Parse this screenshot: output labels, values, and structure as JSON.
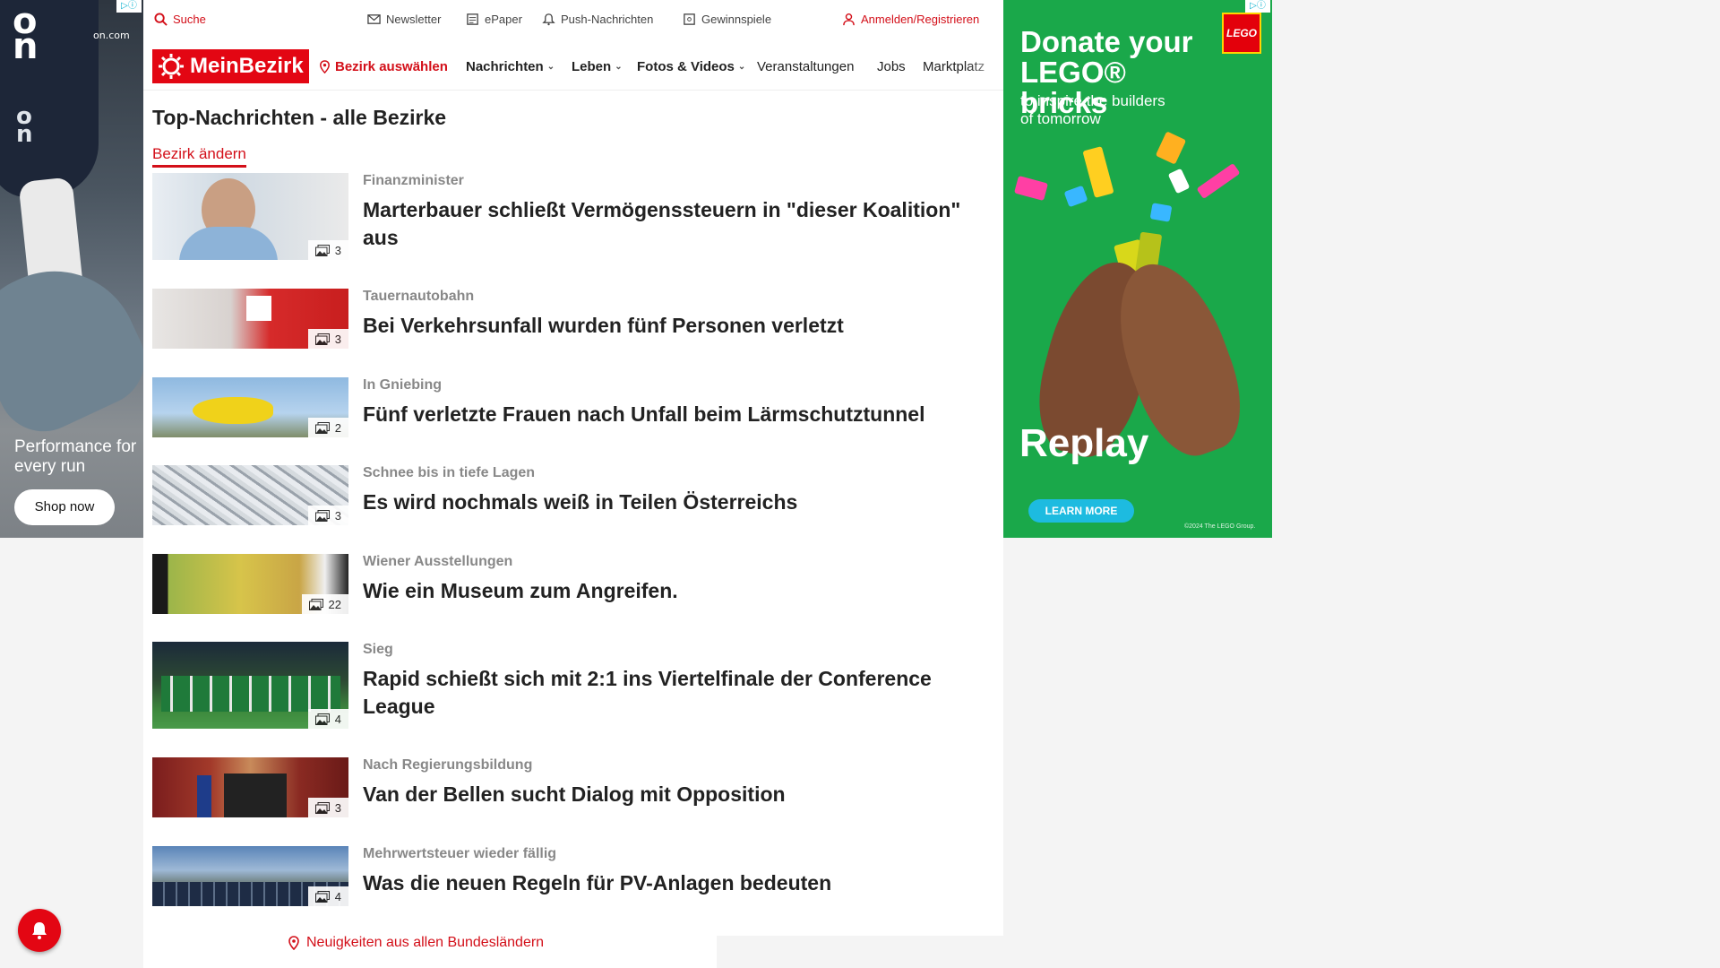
{
  "left_ad": {
    "brand": "On",
    "site": "on.com",
    "slogan": "Performance for every run",
    "cta": "Shop now"
  },
  "topbar": {
    "search": "Suche",
    "newsletter": "Newsletter",
    "epaper": "ePaper",
    "push": "Push-Nachrichten",
    "gewinnspiele": "Gewinnspiele",
    "login": "Anmelden/Registrieren"
  },
  "nav": {
    "logo": "MeinBezirk",
    "bezirk": "Bezirk auswählen",
    "items": [
      "Nachrichten",
      "Leben",
      "Fotos & Videos",
      "Veranstaltungen",
      "Jobs",
      "Marktplatz"
    ]
  },
  "page": {
    "title": "Top-Nachrichten - alle Bezirke",
    "change_link": "Bezirk ändern"
  },
  "articles": [
    {
      "kicker": "Finanzminister",
      "headline": "Marterbauer schließt Vermögenssteuern in \"dieser Koalition\" aus",
      "count": "3"
    },
    {
      "kicker": "Tauernautobahn",
      "headline": "Bei Verkehrsunfall wurden fünf Personen verletzt",
      "count": "3"
    },
    {
      "kicker": "In Gniebing",
      "headline": "Fünf verletzte Frauen nach Unfall beim Lärmschutztunnel",
      "count": "2"
    },
    {
      "kicker": "Schnee bis in tiefe Lagen",
      "headline": "Es wird nochmals weiß in Teilen Österreichs",
      "count": "3"
    },
    {
      "kicker": "Wiener Ausstellungen",
      "headline": "Wie ein Museum zum Angreifen.",
      "count": "22"
    },
    {
      "kicker": "Sieg",
      "headline": "Rapid schießt sich mit 2:1 ins Viertelfinale der Conference League",
      "count": "4"
    },
    {
      "kicker": "Nach Regierungsbildung",
      "headline": "Van der Bellen sucht Dialog mit Opposition",
      "count": "3"
    },
    {
      "kicker": "Mehrwertsteuer wieder fällig",
      "headline": "Was die neuen Regeln für PV-Anlagen bedeuten",
      "count": "4"
    }
  ],
  "footer": {
    "link": "Neuigkeiten aus allen Bundesländern"
  },
  "right_ad": {
    "headline": "Donate your LEGO® bricks",
    "sub": "to inspire the builders of tomorrow",
    "logo": "LEGO",
    "replay": "Replay",
    "cta": "LEARN MORE",
    "copyright": "©2024 The LEGO Group."
  },
  "colors": {
    "brand_red": "#e30613",
    "link_red": "#d30f19",
    "lego_green": "#1aa84a"
  }
}
